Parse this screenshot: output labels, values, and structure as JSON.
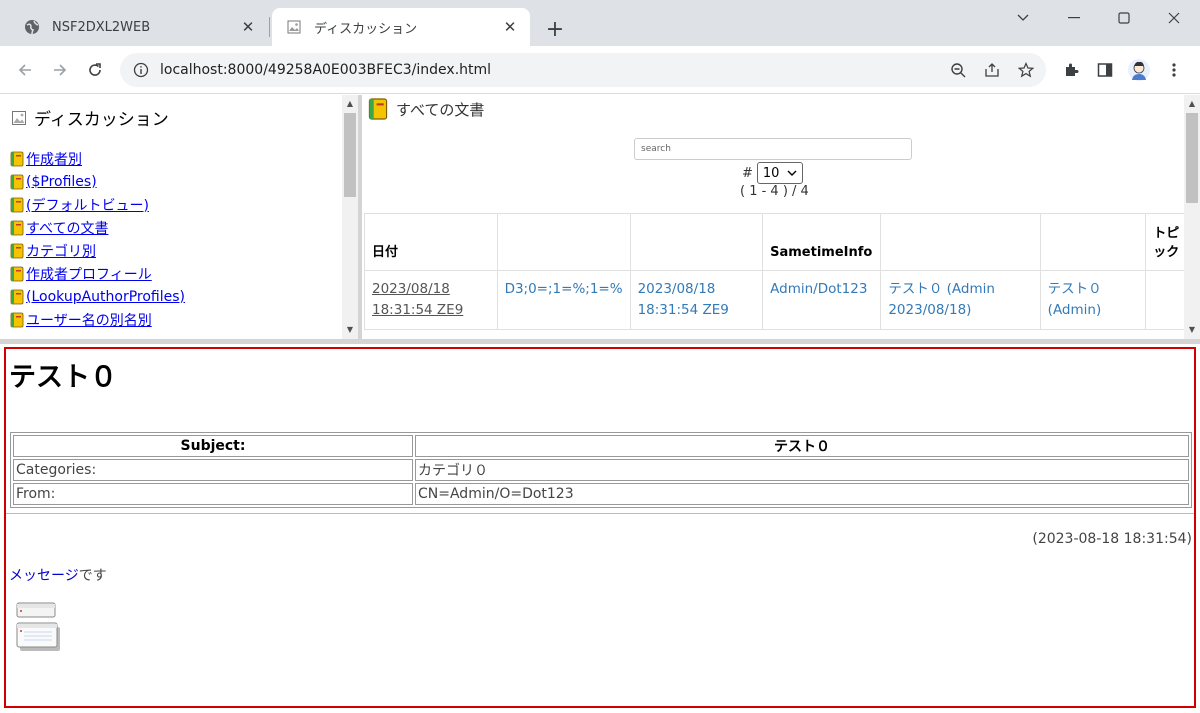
{
  "browser": {
    "tabs": [
      {
        "title": "NSF2DXL2WEB",
        "icon": "globe-icon",
        "active": false
      },
      {
        "title": "ディスカッション",
        "icon": "image-icon",
        "active": true
      }
    ],
    "url": "localhost:8000/49258A0E003BFEC3/index.html"
  },
  "nav": {
    "title": "ディスカッション",
    "items": [
      {
        "label": "作成者別"
      },
      {
        "label": "($Profiles)"
      },
      {
        "label": "(デフォルトビュー)"
      },
      {
        "label": "すべての文書"
      },
      {
        "label": "カテゴリ別"
      },
      {
        "label": "作成者プロフィール"
      },
      {
        "label": "(LookupAuthorProfiles)"
      },
      {
        "label": "ユーザー名の別名別"
      }
    ]
  },
  "view": {
    "title": "すべての文書",
    "search_placeholder": "search",
    "page_size_label": "#",
    "page_size": "10",
    "range_text": "( 1 - 4 ) / 4",
    "columns": [
      "日付",
      "",
      "",
      "SametimeInfo",
      "",
      "",
      "トピック"
    ],
    "rows": [
      {
        "date": "2023/08/18 18:31:54 ZE9",
        "col2": "D3;0=;1=%;1=%",
        "col3": "2023/08/18 18:31:54 ZE9",
        "sametime": "Admin/Dot123",
        "col5": "テスト０ (Admin 2023/08/18)",
        "col6": "テスト０ (Admin)",
        "topic": ""
      }
    ]
  },
  "document": {
    "title": "テスト０",
    "subject_label": "Subject:",
    "subject_value": "テスト０",
    "categories_label": "Categories:",
    "categories_value": "カテゴリ０",
    "from_label": "From:",
    "from_value": "CN=Admin/O=Dot123",
    "timestamp": "(2023-08-18 18:31:54)",
    "message_link": "メッセージ",
    "message_suffix": "です",
    "attachment_icon": "attachment-stack-icon"
  },
  "colors": {
    "tab_strip": "#dee1e6",
    "link": "#0000ee",
    "view_link": "#337ab7",
    "doc_border": "#d00000"
  }
}
